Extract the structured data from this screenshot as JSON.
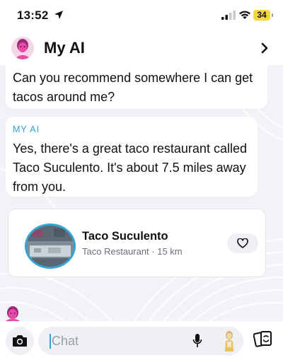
{
  "status_bar": {
    "time": "13:52",
    "battery": "34"
  },
  "header": {
    "title": "My AI"
  },
  "messages": {
    "user_text": "Can you recommend somewhere I can get tacos around me?",
    "ai_sender": "MY AI",
    "ai_text": "Yes, there's a great taco restaurant called Taco Suculento. It's about 7.5 miles away from you."
  },
  "place_card": {
    "name": "Taco Suculento",
    "meta": "Taco Restaurant · 15 km"
  },
  "chat_input": {
    "placeholder": "Chat"
  },
  "icons": {
    "location": "location-arrow-icon",
    "signal": "cellular-signal-icon",
    "wifi": "wifi-icon",
    "chevron": "chevron-right-icon",
    "heart": "heart-icon",
    "camera": "camera-icon",
    "mic": "microphone-icon",
    "cards": "sticker-cards-icon"
  },
  "colors": {
    "accent": "#33a4d3",
    "battery": "#f5d63c",
    "background": "#f2f3f6"
  }
}
